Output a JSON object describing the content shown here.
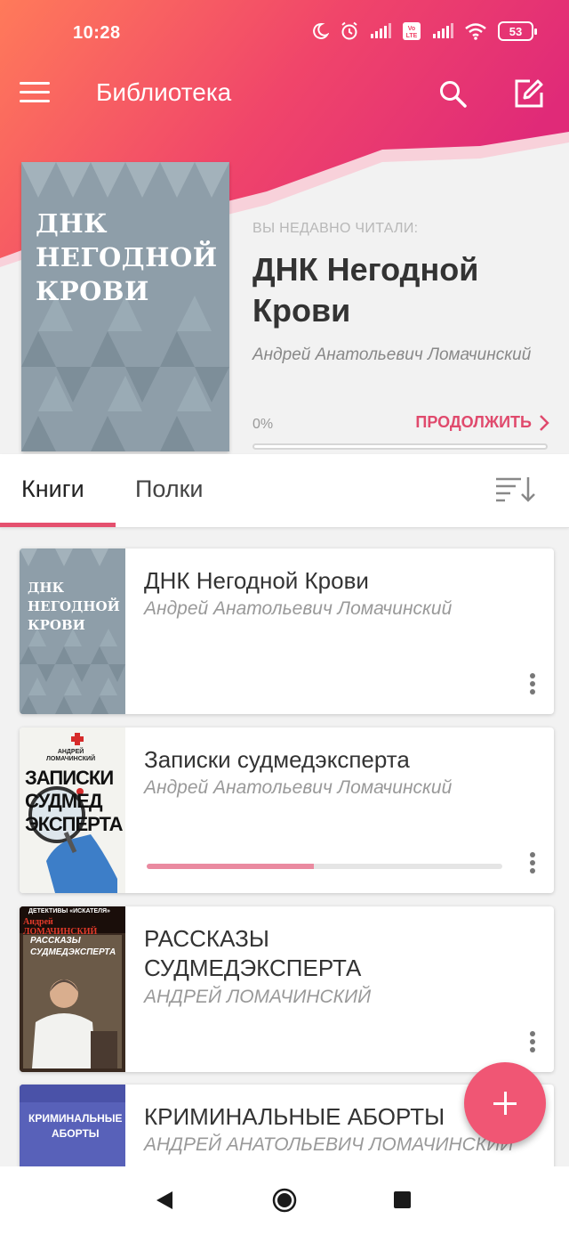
{
  "status_bar": {
    "time": "10:28",
    "battery": "53",
    "lte_label": "LTE"
  },
  "toolbar": {
    "title": "Библиотека",
    "menu_icon": "menu-icon",
    "search_icon": "search-icon",
    "edit_icon": "edit-icon"
  },
  "recent": {
    "label": "ВЫ НЕДАВНО ЧИТАЛИ:",
    "title": "ДНК Негодной Крови",
    "cover_title": "ДНК\nНЕГОДНОЙ\nКРОВИ",
    "author": "Андрей Анатольевич Ломачинский",
    "progress_text": "0%",
    "progress": 0,
    "continue_label": "ПРОДОЛЖИТЬ"
  },
  "tabs": {
    "books": "Книги",
    "shelves": "Полки",
    "active": "books"
  },
  "books": [
    {
      "title": "ДНК Негодной Крови",
      "author": "Андрей Анатольевич Ломачинский",
      "cover_text": "ДНК\nНЕГОДНОЙ\nКРОВИ",
      "progress": null
    },
    {
      "title": "Записки судмедэксперта",
      "author": "Андрей Анатольевич Ломачинский",
      "cover_author": "АНДРЕЙ\nЛОМАЧИНСКИЙ",
      "cover_text": "ЗАПИСКИ\nСУДМЕД\nЭКСПЕРТА",
      "progress": 0.47
    },
    {
      "title": "РАССКАЗЫ СУДМЕДЭКСПЕРТА",
      "author": "АНДРЕЙ ЛОМАЧИНСКИЙ",
      "cover_series": "ДЕТЕКТИВЫ «ИСКАТЕЛЯ»",
      "cover_author": "Андрей ЛОМАЧИНСКИЙ",
      "cover_text": "РАССКАЗЫ\nСУДМЕДЭКСПЕРТА",
      "progress": null
    },
    {
      "title": "КРИМИНАЛЬНЫЕ АБОРТЫ",
      "author": "АНДРЕЙ АНАТОЛЬЕВИЧ ЛОМАЧИНСКИЙ",
      "cover_text": "КРИМИНАЛЬНЫЕ\nАБОРТЫ",
      "progress": null
    }
  ],
  "colors": {
    "accent": "#e5506e",
    "header_start": "#ff7a5a",
    "header_end": "#e52e73",
    "fab": "#f05674"
  }
}
